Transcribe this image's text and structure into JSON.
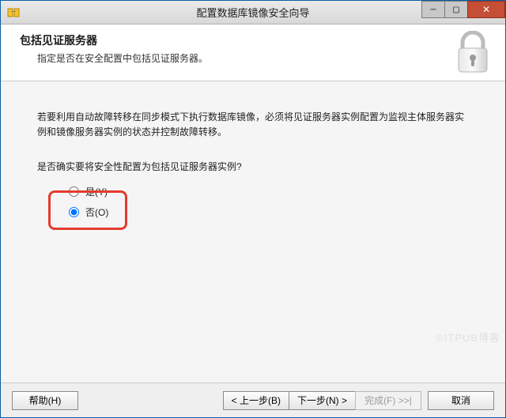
{
  "window": {
    "title": "配置数据库镜像安全向导"
  },
  "header": {
    "heading": "包括见证服务器",
    "subheading": "指定是否在安全配置中包括见证服务器。"
  },
  "body": {
    "paragraph": "若要利用自动故障转移在同步模式下执行数据库镜像，必须将见证服务器实例配置为监视主体服务器实例和镜像服务器实例的状态并控制故障转移。",
    "question": "是否确实要将安全性配置为包括见证服务器实例?",
    "option_yes": "是(Y)",
    "option_no": "否(O)"
  },
  "footer": {
    "help": "帮助(H)",
    "back": "< 上一步(B)",
    "next": "下一步(N) >",
    "finish": "完成(F) >>|",
    "cancel": "取消"
  },
  "watermark": "©ITPUB博客"
}
